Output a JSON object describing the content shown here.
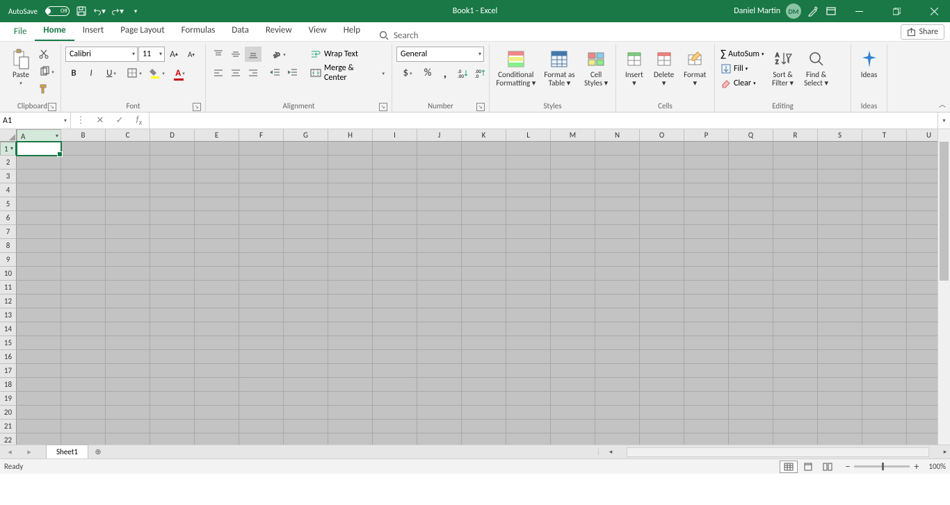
{
  "title_bar": {
    "autosave_label": "AutoSave",
    "autosave_state": "Off",
    "document_title": "Book1  -  Excel",
    "user_name": "Daniel Martin",
    "user_initials": "DM"
  },
  "tabs": {
    "file": "File",
    "items": [
      "Home",
      "Insert",
      "Page Layout",
      "Formulas",
      "Data",
      "Review",
      "View",
      "Help"
    ],
    "active_index": 0,
    "search_placeholder": "Search",
    "share_label": "Share"
  },
  "ribbon": {
    "clipboard": {
      "paste": "Paste",
      "label": "Clipboard"
    },
    "font": {
      "name": "Calibri",
      "size": "11",
      "label": "Font"
    },
    "alignment": {
      "wrap": "Wrap Text",
      "merge": "Merge & Center",
      "label": "Alignment"
    },
    "number": {
      "format": "General",
      "label": "Number"
    },
    "styles": {
      "cond": "Conditional Formatting",
      "table": "Format as Table",
      "cell": "Cell Styles",
      "label": "Styles"
    },
    "cells": {
      "insert": "Insert",
      "delete": "Delete",
      "format": "Format",
      "label": "Cells"
    },
    "editing": {
      "autosum": "AutoSum",
      "fill": "Fill",
      "clear": "Clear",
      "sort": "Sort & Filter",
      "find": "Find & Select",
      "label": "Editing"
    },
    "ideas": {
      "ideas": "Ideas",
      "label": "Ideas"
    }
  },
  "formula_bar": {
    "name_box": "A1",
    "formula": ""
  },
  "grid": {
    "columns": [
      "A",
      "B",
      "C",
      "D",
      "E",
      "F",
      "G",
      "H",
      "I",
      "J",
      "K",
      "L",
      "M",
      "N",
      "O",
      "P",
      "Q",
      "R",
      "S",
      "T",
      "U"
    ],
    "rows": [
      1,
      2,
      3,
      4,
      5,
      6,
      7,
      8,
      9,
      10,
      11,
      12,
      13,
      14,
      15,
      16,
      17,
      18,
      19,
      20,
      21,
      22
    ],
    "active": {
      "col": 0,
      "row": 0
    }
  },
  "sheet_tabs": {
    "active": "Sheet1"
  },
  "status_bar": {
    "state": "Ready",
    "zoom": "100%"
  }
}
